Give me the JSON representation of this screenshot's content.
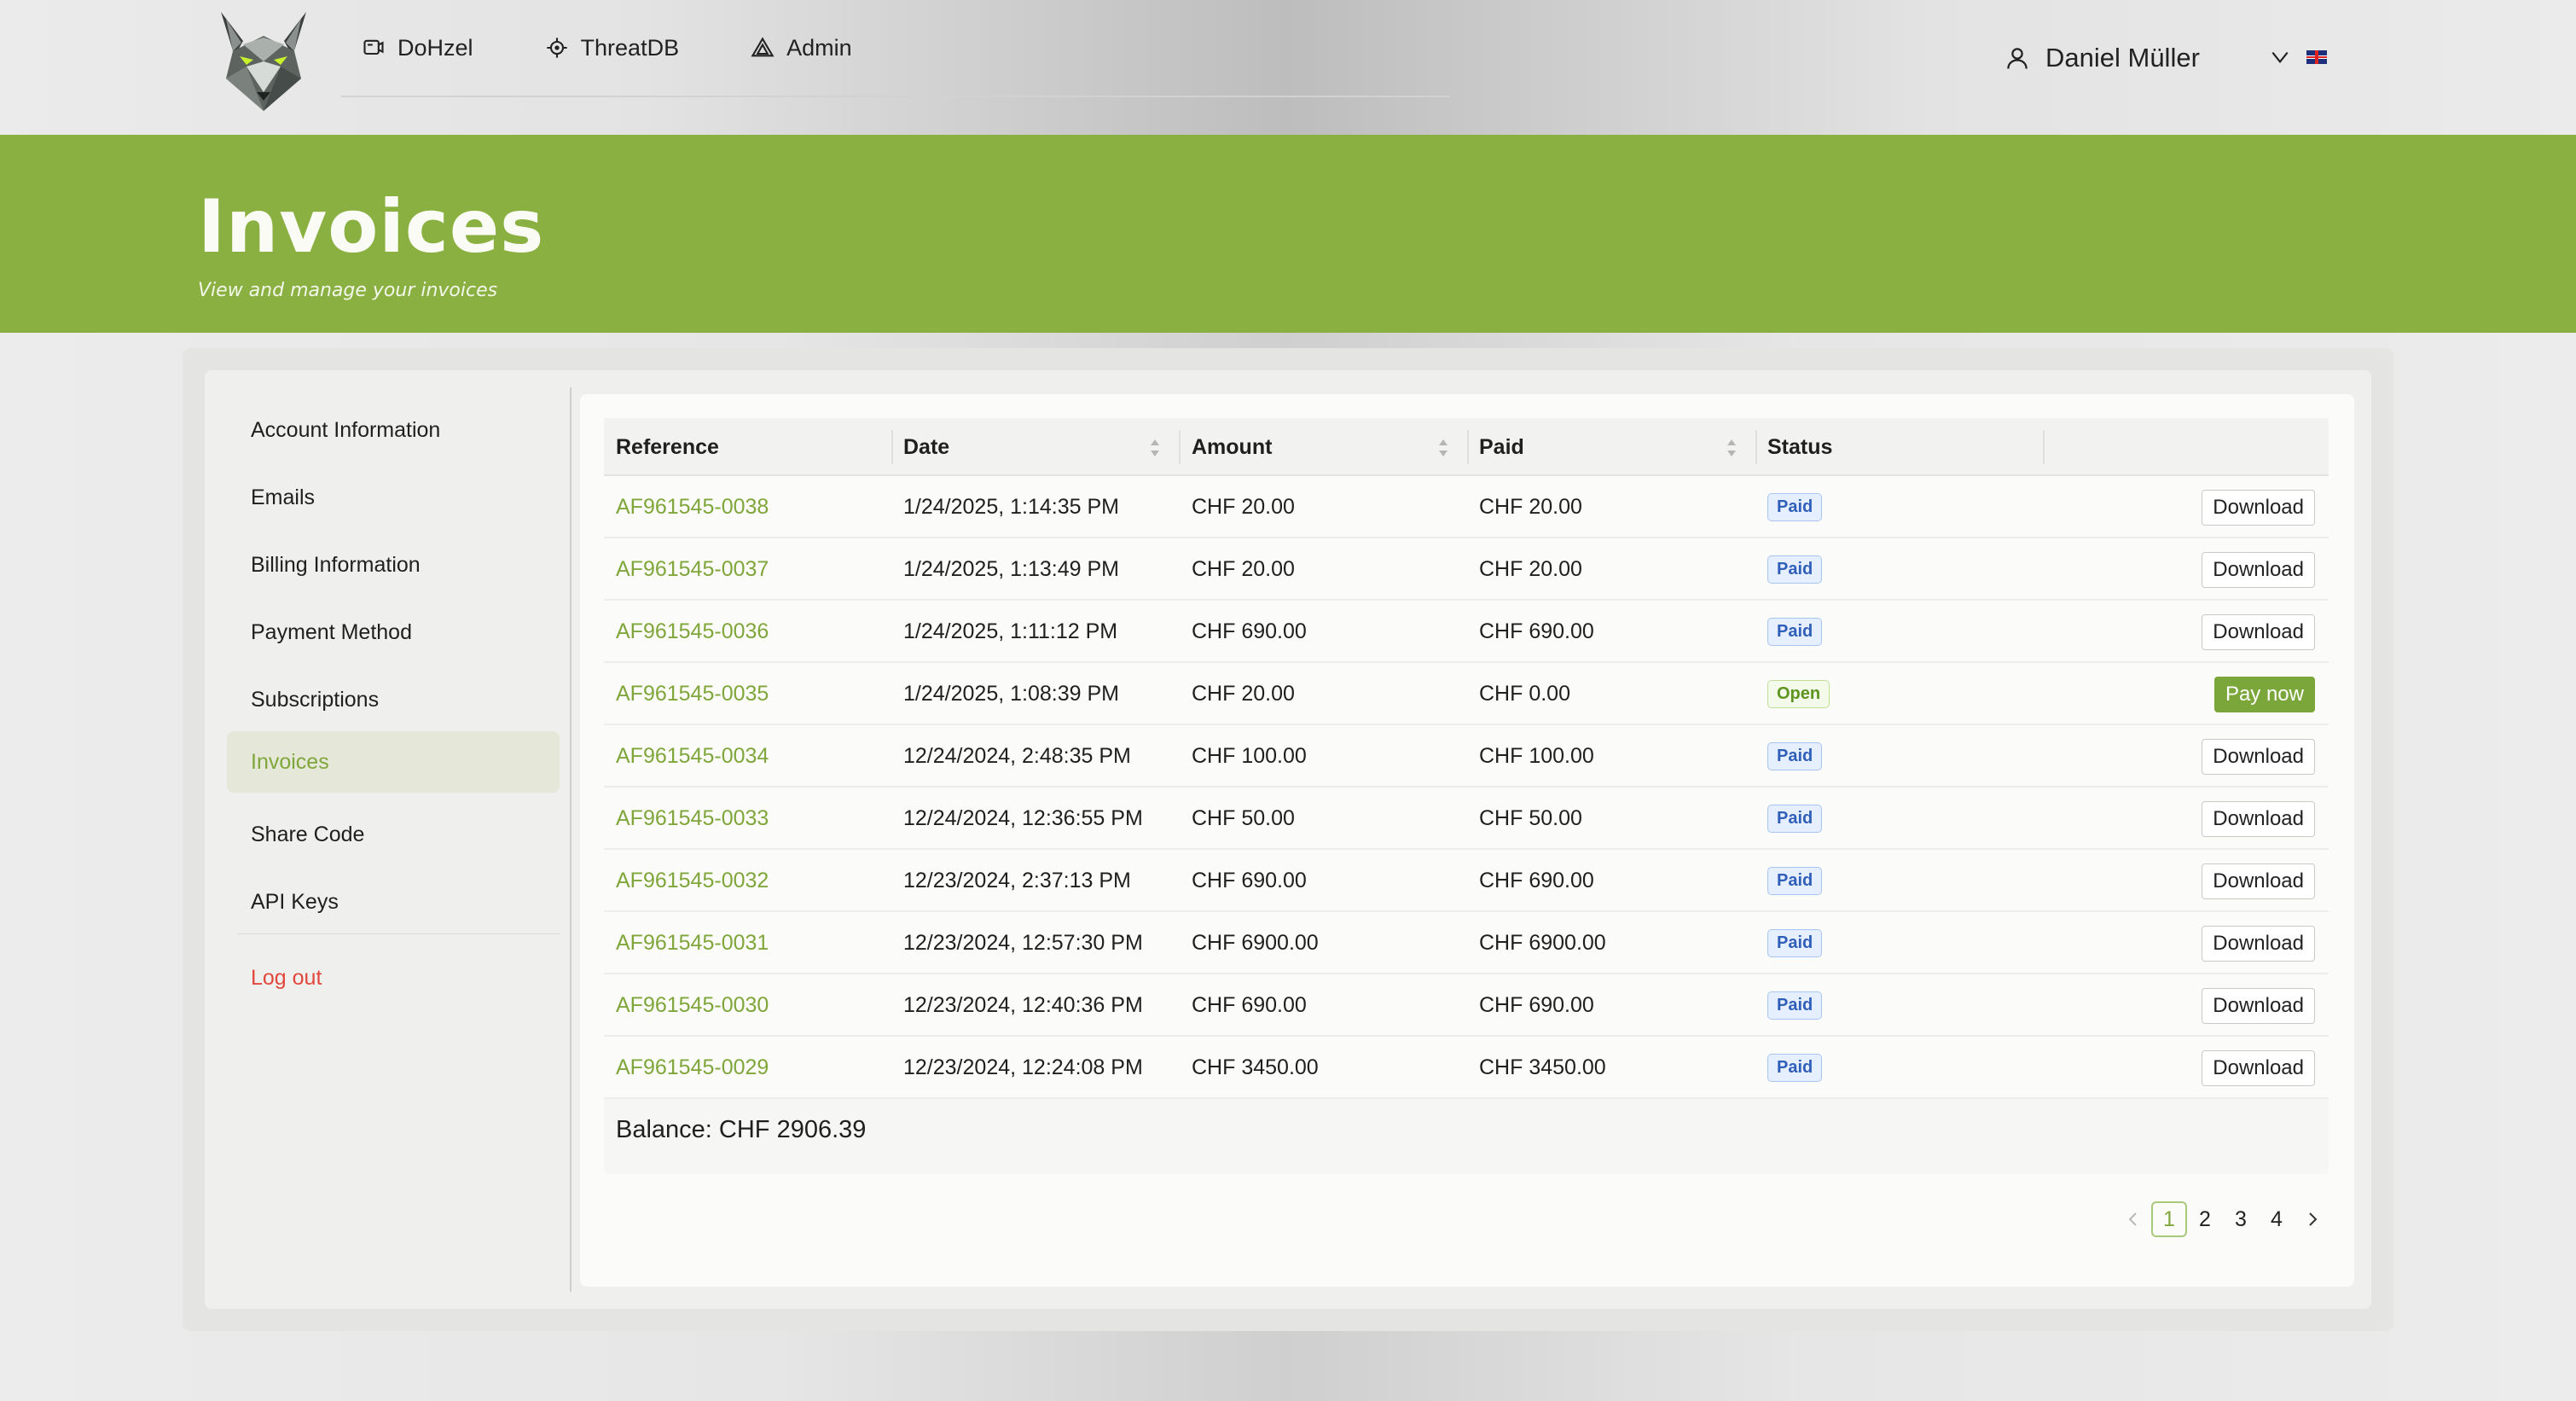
{
  "nav": {
    "items": [
      {
        "label": "DoHzel",
        "icon": "frame-icon"
      },
      {
        "label": "ThreatDB",
        "icon": "crosshair-icon"
      },
      {
        "label": "Admin",
        "icon": "triangle-warning-icon"
      }
    ],
    "user": "Daniel Müller"
  },
  "hero": {
    "title": "Invoices",
    "subtitle": "View and manage your invoices"
  },
  "sidebar": {
    "items": [
      {
        "label": "Account Information"
      },
      {
        "label": "Emails"
      },
      {
        "label": "Billing Information"
      },
      {
        "label": "Payment Method"
      },
      {
        "label": "Subscriptions"
      },
      {
        "label": "Invoices",
        "active": true
      },
      {
        "label": "Share Code"
      },
      {
        "label": "API Keys"
      }
    ],
    "logout": "Log out"
  },
  "table": {
    "headers": {
      "reference": "Reference",
      "date": "Date",
      "amount": "Amount",
      "paid": "Paid",
      "status": "Status"
    },
    "rows": [
      {
        "ref": "AF961545-0038",
        "date": "1/24/2025, 1:14:35 PM",
        "amount": "CHF 20.00",
        "paid": "CHF 20.00",
        "status": "Paid",
        "action": "Download"
      },
      {
        "ref": "AF961545-0037",
        "date": "1/24/2025, 1:13:49 PM",
        "amount": "CHF 20.00",
        "paid": "CHF 20.00",
        "status": "Paid",
        "action": "Download"
      },
      {
        "ref": "AF961545-0036",
        "date": "1/24/2025, 1:11:12 PM",
        "amount": "CHF 690.00",
        "paid": "CHF 690.00",
        "status": "Paid",
        "action": "Download"
      },
      {
        "ref": "AF961545-0035",
        "date": "1/24/2025, 1:08:39 PM",
        "amount": "CHF 20.00",
        "paid": "CHF 0.00",
        "status": "Open",
        "action": "Pay now"
      },
      {
        "ref": "AF961545-0034",
        "date": "12/24/2024, 2:48:35 PM",
        "amount": "CHF 100.00",
        "paid": "CHF 100.00",
        "status": "Paid",
        "action": "Download"
      },
      {
        "ref": "AF961545-0033",
        "date": "12/24/2024, 12:36:55 PM",
        "amount": "CHF 50.00",
        "paid": "CHF 50.00",
        "status": "Paid",
        "action": "Download"
      },
      {
        "ref": "AF961545-0032",
        "date": "12/23/2024, 2:37:13 PM",
        "amount": "CHF 690.00",
        "paid": "CHF 690.00",
        "status": "Paid",
        "action": "Download"
      },
      {
        "ref": "AF961545-0031",
        "date": "12/23/2024, 12:57:30 PM",
        "amount": "CHF 6900.00",
        "paid": "CHF 6900.00",
        "status": "Paid",
        "action": "Download"
      },
      {
        "ref": "AF961545-0030",
        "date": "12/23/2024, 12:40:36 PM",
        "amount": "CHF 690.00",
        "paid": "CHF 690.00",
        "status": "Paid",
        "action": "Download"
      },
      {
        "ref": "AF961545-0029",
        "date": "12/23/2024, 12:24:08 PM",
        "amount": "CHF 3450.00",
        "paid": "CHF 3450.00",
        "status": "Paid",
        "action": "Download"
      }
    ],
    "balance": "Balance: CHF 2906.39"
  },
  "pagination": {
    "pages": [
      "1",
      "2",
      "3",
      "4"
    ],
    "current": "1"
  },
  "colors": {
    "brand_green": "#8ab041",
    "link_green": "#7fa63a",
    "paid_blue": "#2f5fb8",
    "logout_red": "#e2473d"
  }
}
